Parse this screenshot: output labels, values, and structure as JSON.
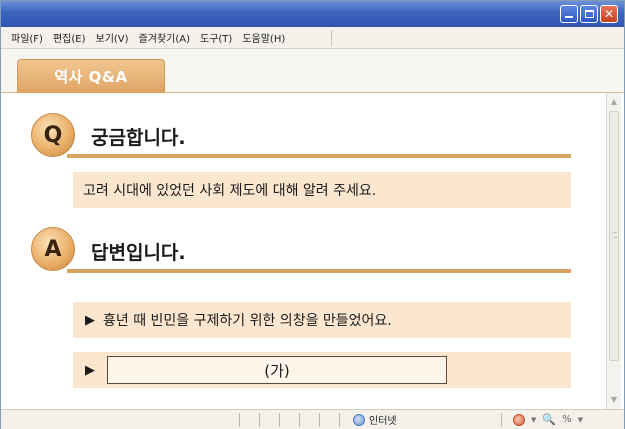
{
  "menu": {
    "items": [
      "파일(F)",
      "편집(E)",
      "보기(V)",
      "즐겨찾기(A)",
      "도구(T)",
      "도움말(H)"
    ]
  },
  "tab": {
    "label": "역사 Q&A"
  },
  "question": {
    "badge": "Q",
    "heading": "궁금합니다.",
    "text": "고려 시대에 있었던 사회 제도에 대해 알려 주세요."
  },
  "answer": {
    "badge": "A",
    "heading": "답변입니다.",
    "marker": "▶",
    "items": [
      "흉년 때 빈민을 구제하기 위한 의창을 만들었어요."
    ],
    "blank_label": "(가)"
  },
  "statusbar": {
    "zone": "인터넷",
    "zoom_symbol": "%"
  },
  "icons": {
    "minimize": "minimize-icon",
    "maximize": "maximize-icon",
    "close": "close-icon",
    "globe": "globe-icon",
    "security": "security-icon",
    "zoom": "zoom-icon"
  },
  "colors": {
    "titlebar": "#3c64bf",
    "accent": "#d7a464",
    "tab": "#e0a463",
    "box": "#fbe7cf"
  }
}
